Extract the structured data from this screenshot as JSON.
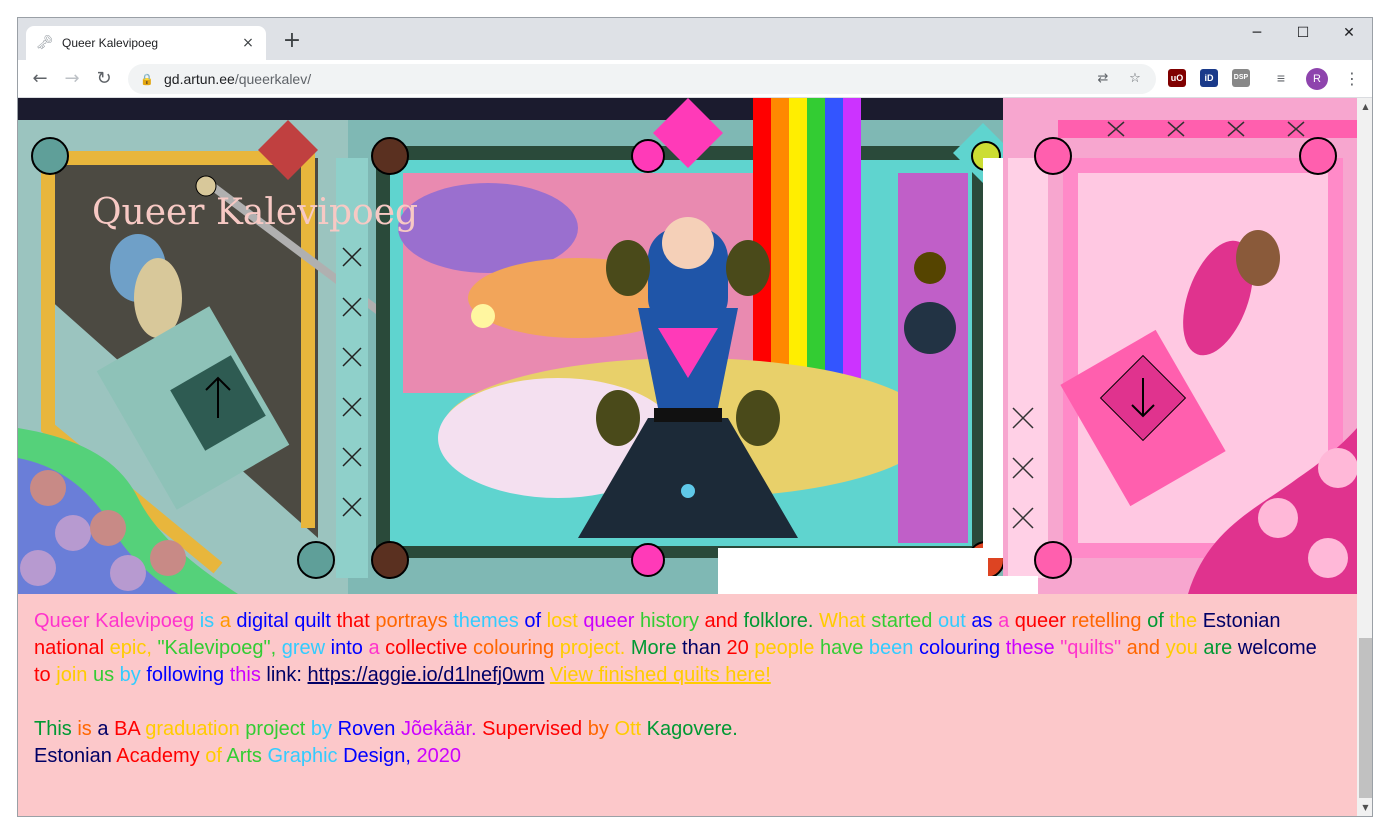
{
  "browser": {
    "tab_title": "Queer Kalevipoeg",
    "tab_close": "×",
    "new_tab": "+",
    "url_host": "gd.artun.ee",
    "url_path": "/queerkalev/",
    "avatar_letter": "R",
    "window_controls": {
      "minimize": "─",
      "maximize": "☐",
      "close": "✕"
    },
    "extensions": [
      {
        "name": "ublock-icon",
        "label": "uO",
        "color": "#800000"
      },
      {
        "name": "id-extension-icon",
        "label": "iD",
        "color": "#1a3a8a"
      },
      {
        "name": "dsp-extension-icon",
        "label": "DSP",
        "color": "#888888"
      }
    ]
  },
  "page": {
    "site_title": "Queer Kalevipoeg",
    "description_words": [
      {
        "t": "Queer",
        "c": "#ff33cc"
      },
      {
        "t": "Kalevipoeg",
        "c": "#ff33cc"
      },
      {
        "t": "is",
        "c": "#33ccff"
      },
      {
        "t": "a",
        "c": "#ff9900"
      },
      {
        "t": "digital",
        "c": "#0000ff"
      },
      {
        "t": "quilt",
        "c": "#0000ff"
      },
      {
        "t": "that",
        "c": "#ff0000"
      },
      {
        "t": "portrays",
        "c": "#ff6600"
      },
      {
        "t": "themes",
        "c": "#33ccff"
      },
      {
        "t": "of",
        "c": "#0000ff"
      },
      {
        "t": "lost",
        "c": "#ffcc00"
      },
      {
        "t": "queer",
        "c": "#cc00ff"
      },
      {
        "t": "history",
        "c": "#33cc33"
      },
      {
        "t": "and",
        "c": "#ff0000"
      },
      {
        "t": "folklore.",
        "c": "#009933"
      },
      {
        "t": "What",
        "c": "#ffcc00"
      },
      {
        "t": "started",
        "c": "#33cc33"
      },
      {
        "t": "out",
        "c": "#33ccff"
      },
      {
        "t": "as",
        "c": "#0000ff"
      },
      {
        "t": "a",
        "c": "#ff33cc"
      },
      {
        "t": "queer",
        "c": "#ff0000"
      },
      {
        "t": "retelling",
        "c": "#ff6600"
      },
      {
        "t": "of",
        "c": "#009933"
      },
      {
        "t": "the",
        "c": "#ffcc00"
      },
      {
        "t": "Estonian",
        "c": "#000066"
      },
      {
        "t": "national",
        "c": "#ff0000"
      },
      {
        "t": "epic,",
        "c": "#ffcc00"
      },
      {
        "t": "\"Kalevipoeg\",",
        "c": "#33cc33"
      },
      {
        "t": "grew",
        "c": "#33ccff"
      },
      {
        "t": "into",
        "c": "#0000ff"
      },
      {
        "t": "a",
        "c": "#ff33cc"
      },
      {
        "t": "collective",
        "c": "#ff0000"
      },
      {
        "t": "colouring",
        "c": "#ff6600"
      },
      {
        "t": "project.",
        "c": "#ffcc00"
      },
      {
        "t": "More",
        "c": "#009933"
      },
      {
        "t": "than",
        "c": "#000066"
      },
      {
        "t": "20",
        "c": "#ff0000"
      },
      {
        "t": "people",
        "c": "#ffcc00"
      },
      {
        "t": "have",
        "c": "#33cc33"
      },
      {
        "t": "been",
        "c": "#33ccff"
      },
      {
        "t": "colouring",
        "c": "#0000ff"
      },
      {
        "t": "these",
        "c": "#cc00ff"
      },
      {
        "t": "\"quilts\"",
        "c": "#ff33cc"
      },
      {
        "t": "and",
        "c": "#ff6600"
      },
      {
        "t": "you",
        "c": "#ffcc00"
      },
      {
        "t": "are",
        "c": "#009933"
      },
      {
        "t": "welcome",
        "c": "#000066"
      },
      {
        "t": "to",
        "c": "#ff0000"
      },
      {
        "t": "join",
        "c": "#ffcc00"
      },
      {
        "t": "us",
        "c": "#33cc33"
      },
      {
        "t": "by",
        "c": "#33ccff"
      },
      {
        "t": "following",
        "c": "#0000ff"
      },
      {
        "t": "this",
        "c": "#cc00ff"
      },
      {
        "t": "link:",
        "c": "#000066"
      }
    ],
    "link_url": "https://aggie.io/d1lnefj0wm",
    "link_finished": "View finished quilts here!",
    "credits_line1_words": [
      {
        "t": "This",
        "c": "#009933"
      },
      {
        "t": "is",
        "c": "#ff6600"
      },
      {
        "t": "a",
        "c": "#000066"
      },
      {
        "t": "BA",
        "c": "#ff0000"
      },
      {
        "t": "graduation",
        "c": "#ffcc00"
      },
      {
        "t": "project",
        "c": "#33cc33"
      },
      {
        "t": "by",
        "c": "#33ccff"
      },
      {
        "t": "Roven",
        "c": "#0000ff"
      },
      {
        "t": "Jõekäär.",
        "c": "#cc00ff"
      },
      {
        "t": "Supervised",
        "c": "#ff0000"
      },
      {
        "t": "by",
        "c": "#ff6600"
      },
      {
        "t": "Ott",
        "c": "#ffcc00"
      },
      {
        "t": "Kagovere.",
        "c": "#009933"
      }
    ],
    "credits_line2_words": [
      {
        "t": "Estonian",
        "c": "#000066"
      },
      {
        "t": "Academy",
        "c": "#ff0000"
      },
      {
        "t": "of",
        "c": "#ffcc00"
      },
      {
        "t": "Arts",
        "c": "#33cc33"
      },
      {
        "t": "Graphic",
        "c": "#33ccff"
      },
      {
        "t": "Design,",
        "c": "#0000ff"
      },
      {
        "t": "2020",
        "c": "#cc00ff"
      }
    ]
  }
}
